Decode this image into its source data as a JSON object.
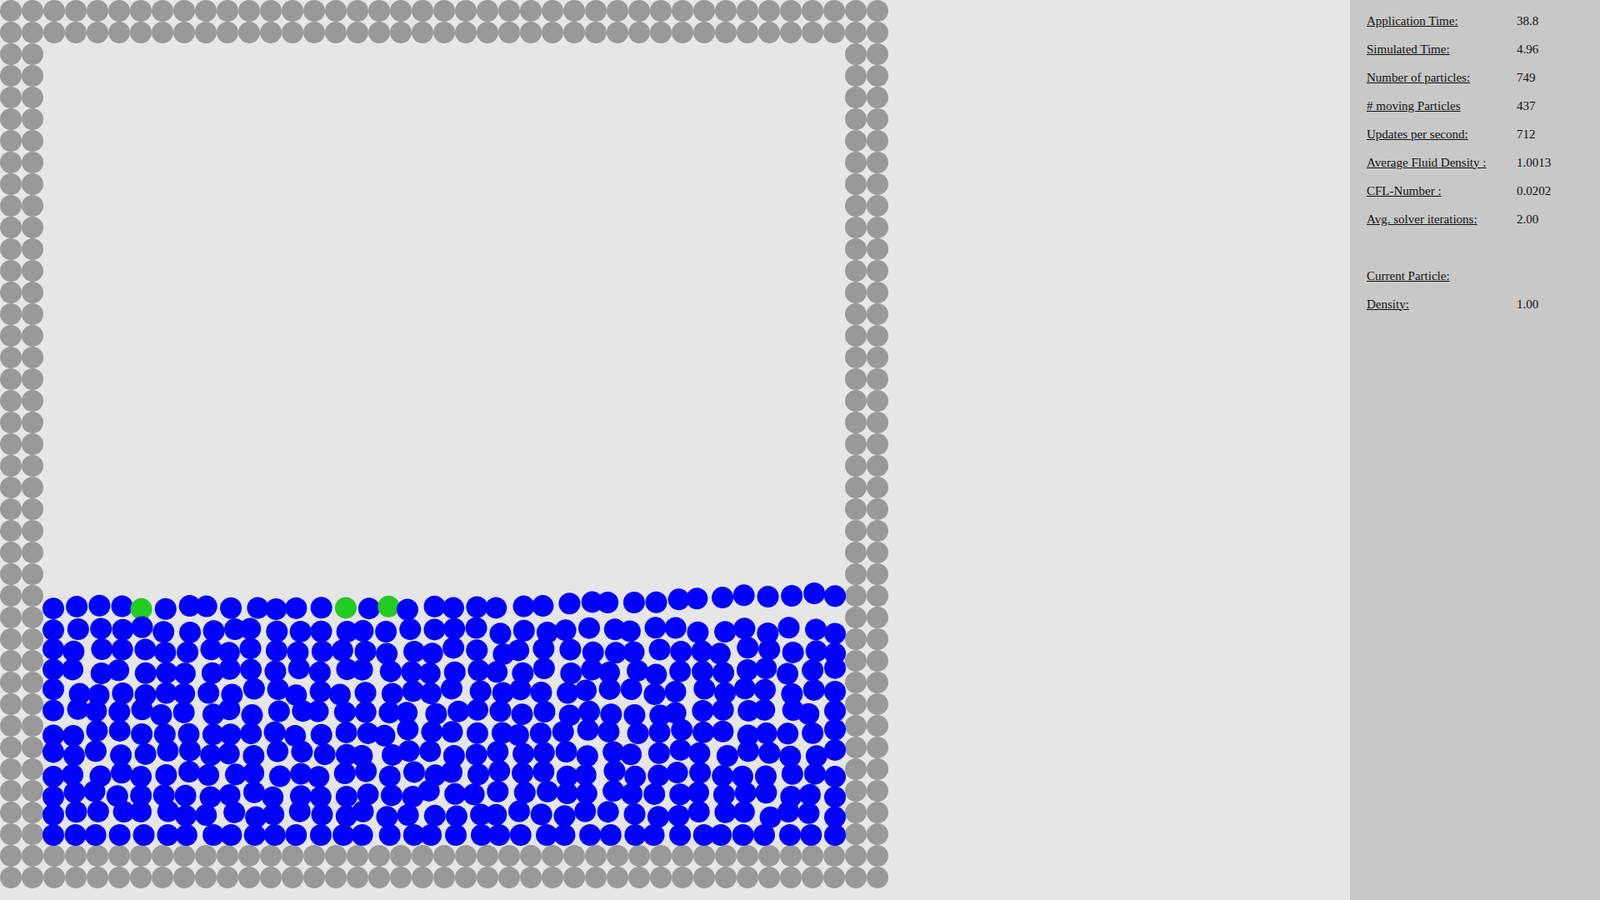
{
  "simulation": {
    "fluid_color": "#0000ff",
    "boundary_color": "#999999",
    "highlighted_particles": [
      {
        "index": 4,
        "color": "#22cc22"
      },
      {
        "index": 13,
        "color": "#22cc22"
      },
      {
        "index": 15,
        "color": "#22cc22"
      }
    ]
  },
  "stats": [
    {
      "label": "Application Time:",
      "value": "38.8"
    },
    {
      "label": "Simulated Time:",
      "value": "4.96"
    },
    {
      "label": "Number of particles:",
      "value": "749"
    },
    {
      "label": "# moving Particles",
      "value": "437"
    },
    {
      "label": "Updates per second:",
      "value": "712"
    },
    {
      "label": "Average Fluid Density :",
      "value": "1.0013"
    },
    {
      "label": "CFL-Number :",
      "value": "0.0202"
    },
    {
      "label": "Avg. solver iterations:",
      "value": "2.00"
    }
  ],
  "current_particle": {
    "title": "Current Particle:",
    "rows": [
      {
        "label": "Density:",
        "value": "1.00"
      }
    ]
  }
}
